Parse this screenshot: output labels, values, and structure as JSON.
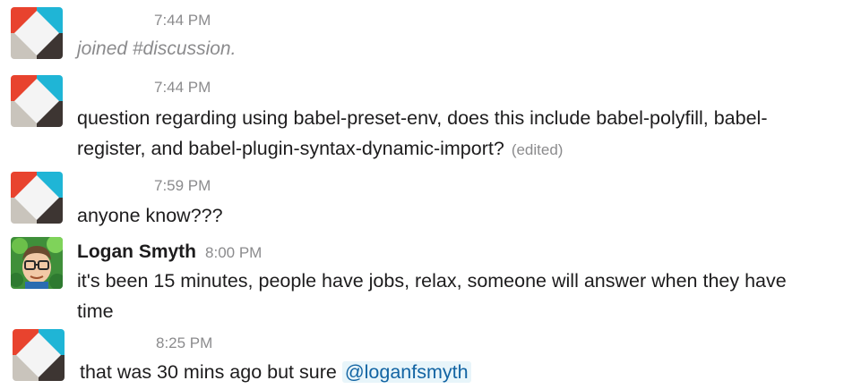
{
  "messages": [
    {
      "author": "",
      "avatar": "red-teal-square-logo",
      "time": "7:44 PM",
      "text": "joined #discussion.",
      "style": "joined"
    },
    {
      "author": "",
      "avatar": "red-teal-square-logo",
      "time": "7:44 PM",
      "text_line1": "question regarding using babel-preset-env, does this include babel-polyfill, babel-",
      "text_line2": "register, and babel-plugin-syntax-dynamic-import?",
      "edited": "(edited)"
    },
    {
      "author": "",
      "avatar": "red-teal-square-logo",
      "time": "7:59 PM",
      "text": "anyone know???"
    },
    {
      "author": "Logan Smyth",
      "avatar": "cartoon-man-glasses",
      "time": "8:00 PM",
      "text_line1": "it's been 15 minutes, people have jobs, relax, someone will answer when they have",
      "text_line2": "time"
    },
    {
      "author": "",
      "avatar": "red-teal-square-logo",
      "time": "8:25 PM",
      "text": "that was 30 mins ago but sure",
      "mention": "@loganfsmyth"
    }
  ],
  "colors": {
    "logo_red": "#e8432e",
    "logo_teal": "#1fb5d6",
    "logo_gray": "#c9c4bc",
    "logo_dark": "#3d3532",
    "mention_bg": "#e8f5fa",
    "mention_text": "#1264a3",
    "timestamp": "#8b8b8d"
  }
}
